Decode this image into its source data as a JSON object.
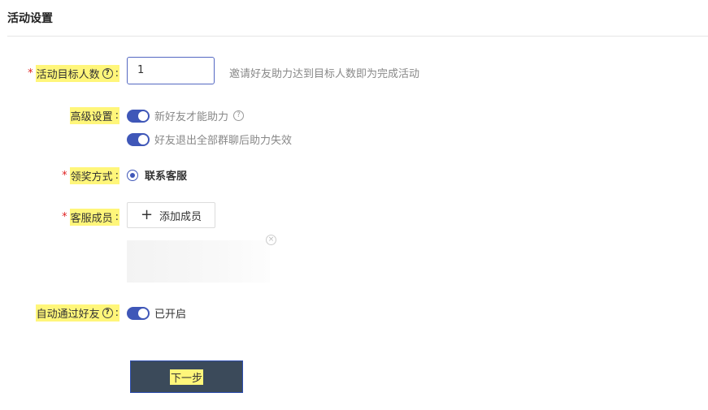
{
  "section": {
    "title": "活动设置"
  },
  "target": {
    "label": "活动目标人数",
    "required_mark": "*",
    "help_icon": "?",
    "colon": ":",
    "value": "1",
    "hint": "邀请好友助力达到目标人数即为完成活动"
  },
  "advanced": {
    "label": "高级设置",
    "colon": ":",
    "options": [
      {
        "label": "新好友才能助力",
        "enabled": true,
        "has_help": true
      },
      {
        "label": "好友退出全部群聊后助力失效",
        "enabled": true,
        "has_help": false
      }
    ],
    "help_icon": "?"
  },
  "reward": {
    "label": "领奖方式",
    "required_mark": "*",
    "colon": ":",
    "selected": "联系客服"
  },
  "service": {
    "label": "客服成员",
    "required_mark": "*",
    "colon": ":",
    "add_button": "添加成员",
    "add_icon": "+",
    "remove_icon": "×"
  },
  "auto_accept": {
    "label": "自动通过好友",
    "help_icon": "?",
    "colon": ":",
    "status": "已开启",
    "enabled": true
  },
  "footer": {
    "next_button": "下一步"
  },
  "colors": {
    "accent": "#3f57b8",
    "highlight": "#fff67a",
    "required": "#e02020",
    "button_bg": "#3b4a5a"
  }
}
